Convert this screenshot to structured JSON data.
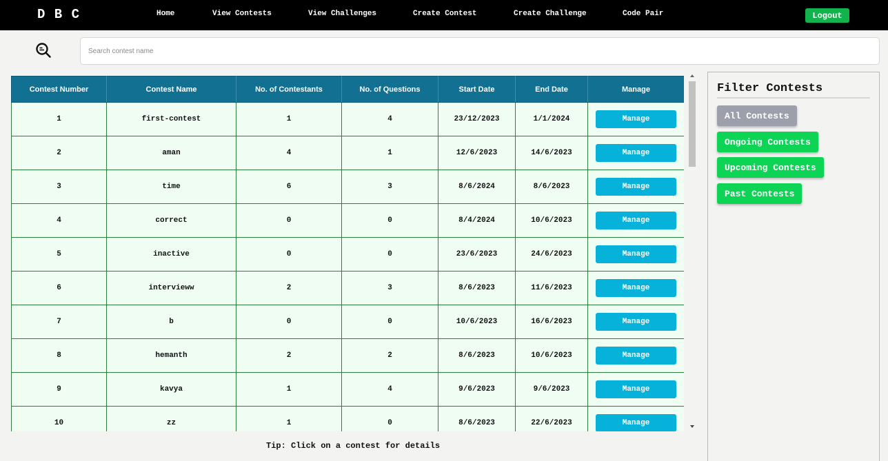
{
  "navbar": {
    "brand": "D B C",
    "links": [
      "Home",
      "View Contests",
      "View Challenges",
      "Create Contest",
      "Create Challenge",
      "Code Pair"
    ],
    "logout_label": "Logout"
  },
  "search": {
    "icon": "search-icon",
    "placeholder": "Search contest name",
    "value": ""
  },
  "table": {
    "columns": [
      "Contest Number",
      "Contest Name",
      "No. of Contestants",
      "No. of Questions",
      "Start Date",
      "End Date",
      "Manage"
    ],
    "rows": [
      [
        "1",
        "first-contest",
        "1",
        "4",
        "23/12/2023",
        "1/1/2024",
        "Manage"
      ],
      [
        "2",
        "aman",
        "4",
        "1",
        "12/6/2023",
        "14/6/2023",
        "Manage"
      ],
      [
        "3",
        "time",
        "6",
        "3",
        "8/6/2024",
        "8/6/2023",
        "Manage"
      ],
      [
        "4",
        "correct",
        "0",
        "0",
        "8/4/2024",
        "10/6/2023",
        "Manage"
      ],
      [
        "5",
        "inactive",
        "0",
        "0",
        "23/6/2023",
        "24/6/2023",
        "Manage"
      ],
      [
        "6",
        "intervieww",
        "2",
        "3",
        "8/6/2023",
        "11/6/2023",
        "Manage"
      ],
      [
        "7",
        "b",
        "0",
        "0",
        "10/6/2023",
        "16/6/2023",
        "Manage"
      ],
      [
        "8",
        "hemanth",
        "2",
        "2",
        "8/6/2023",
        "10/6/2023",
        "Manage"
      ],
      [
        "9",
        "kavya",
        "1",
        "4",
        "9/6/2023",
        "9/6/2023",
        "Manage"
      ],
      [
        "10",
        "zz",
        "1",
        "0",
        "8/6/2023",
        "22/6/2023",
        "Manage"
      ]
    ]
  },
  "tip": "Tip: Click on a contest for details",
  "filter": {
    "title": "Filter Contests",
    "buttons": [
      {
        "label": "All Contests",
        "color": "#9da0aa"
      },
      {
        "label": "Ongoing Contests",
        "color": "#0ed456"
      },
      {
        "label": "Upcoming Contests",
        "color": "#0ed456"
      },
      {
        "label": "Past Contests",
        "color": "#0ed456"
      }
    ]
  },
  "colors": {
    "navbar_bg": "#000000",
    "logout_bg": "#12b34d",
    "table_header_bg": "#127193",
    "row_bg": "#effdf3",
    "row_border": "#2e7d3d",
    "manage_button_bg": "#06b2da"
  }
}
